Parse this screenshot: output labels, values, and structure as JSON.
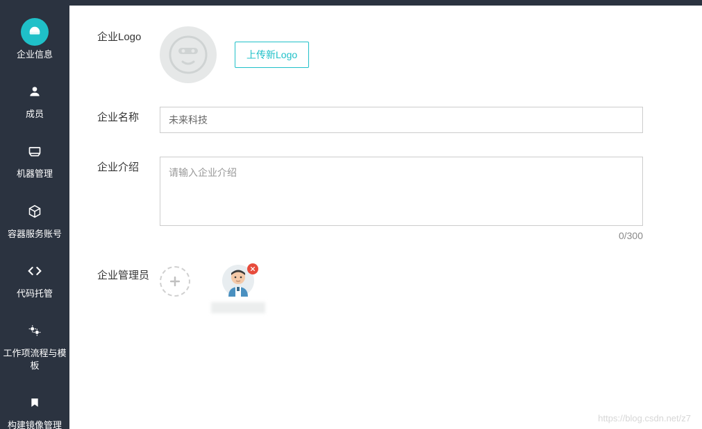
{
  "sidebar": {
    "items": [
      {
        "label": "企业信息",
        "icon": "dashboard-icon"
      },
      {
        "label": "成员",
        "icon": "user-icon"
      },
      {
        "label": "机器管理",
        "icon": "server-icon"
      },
      {
        "label": "容器服务账号",
        "icon": "cube-icon"
      },
      {
        "label": "代码托管",
        "icon": "code-icon"
      },
      {
        "label": "工作项流程与模板",
        "icon": "gears-icon"
      },
      {
        "label": "构建镜像管理",
        "icon": "bookmark-icon"
      }
    ]
  },
  "form": {
    "logo_label": "企业Logo",
    "upload_btn": "上传新Logo",
    "name_label": "企业名称",
    "name_value": "未来科技",
    "intro_label": "企业介绍",
    "intro_placeholder": "请输入企业介绍",
    "char_count": "0/300",
    "admin_label": "企业管理员"
  },
  "watermark": "https://blog.csdn.net/z7"
}
